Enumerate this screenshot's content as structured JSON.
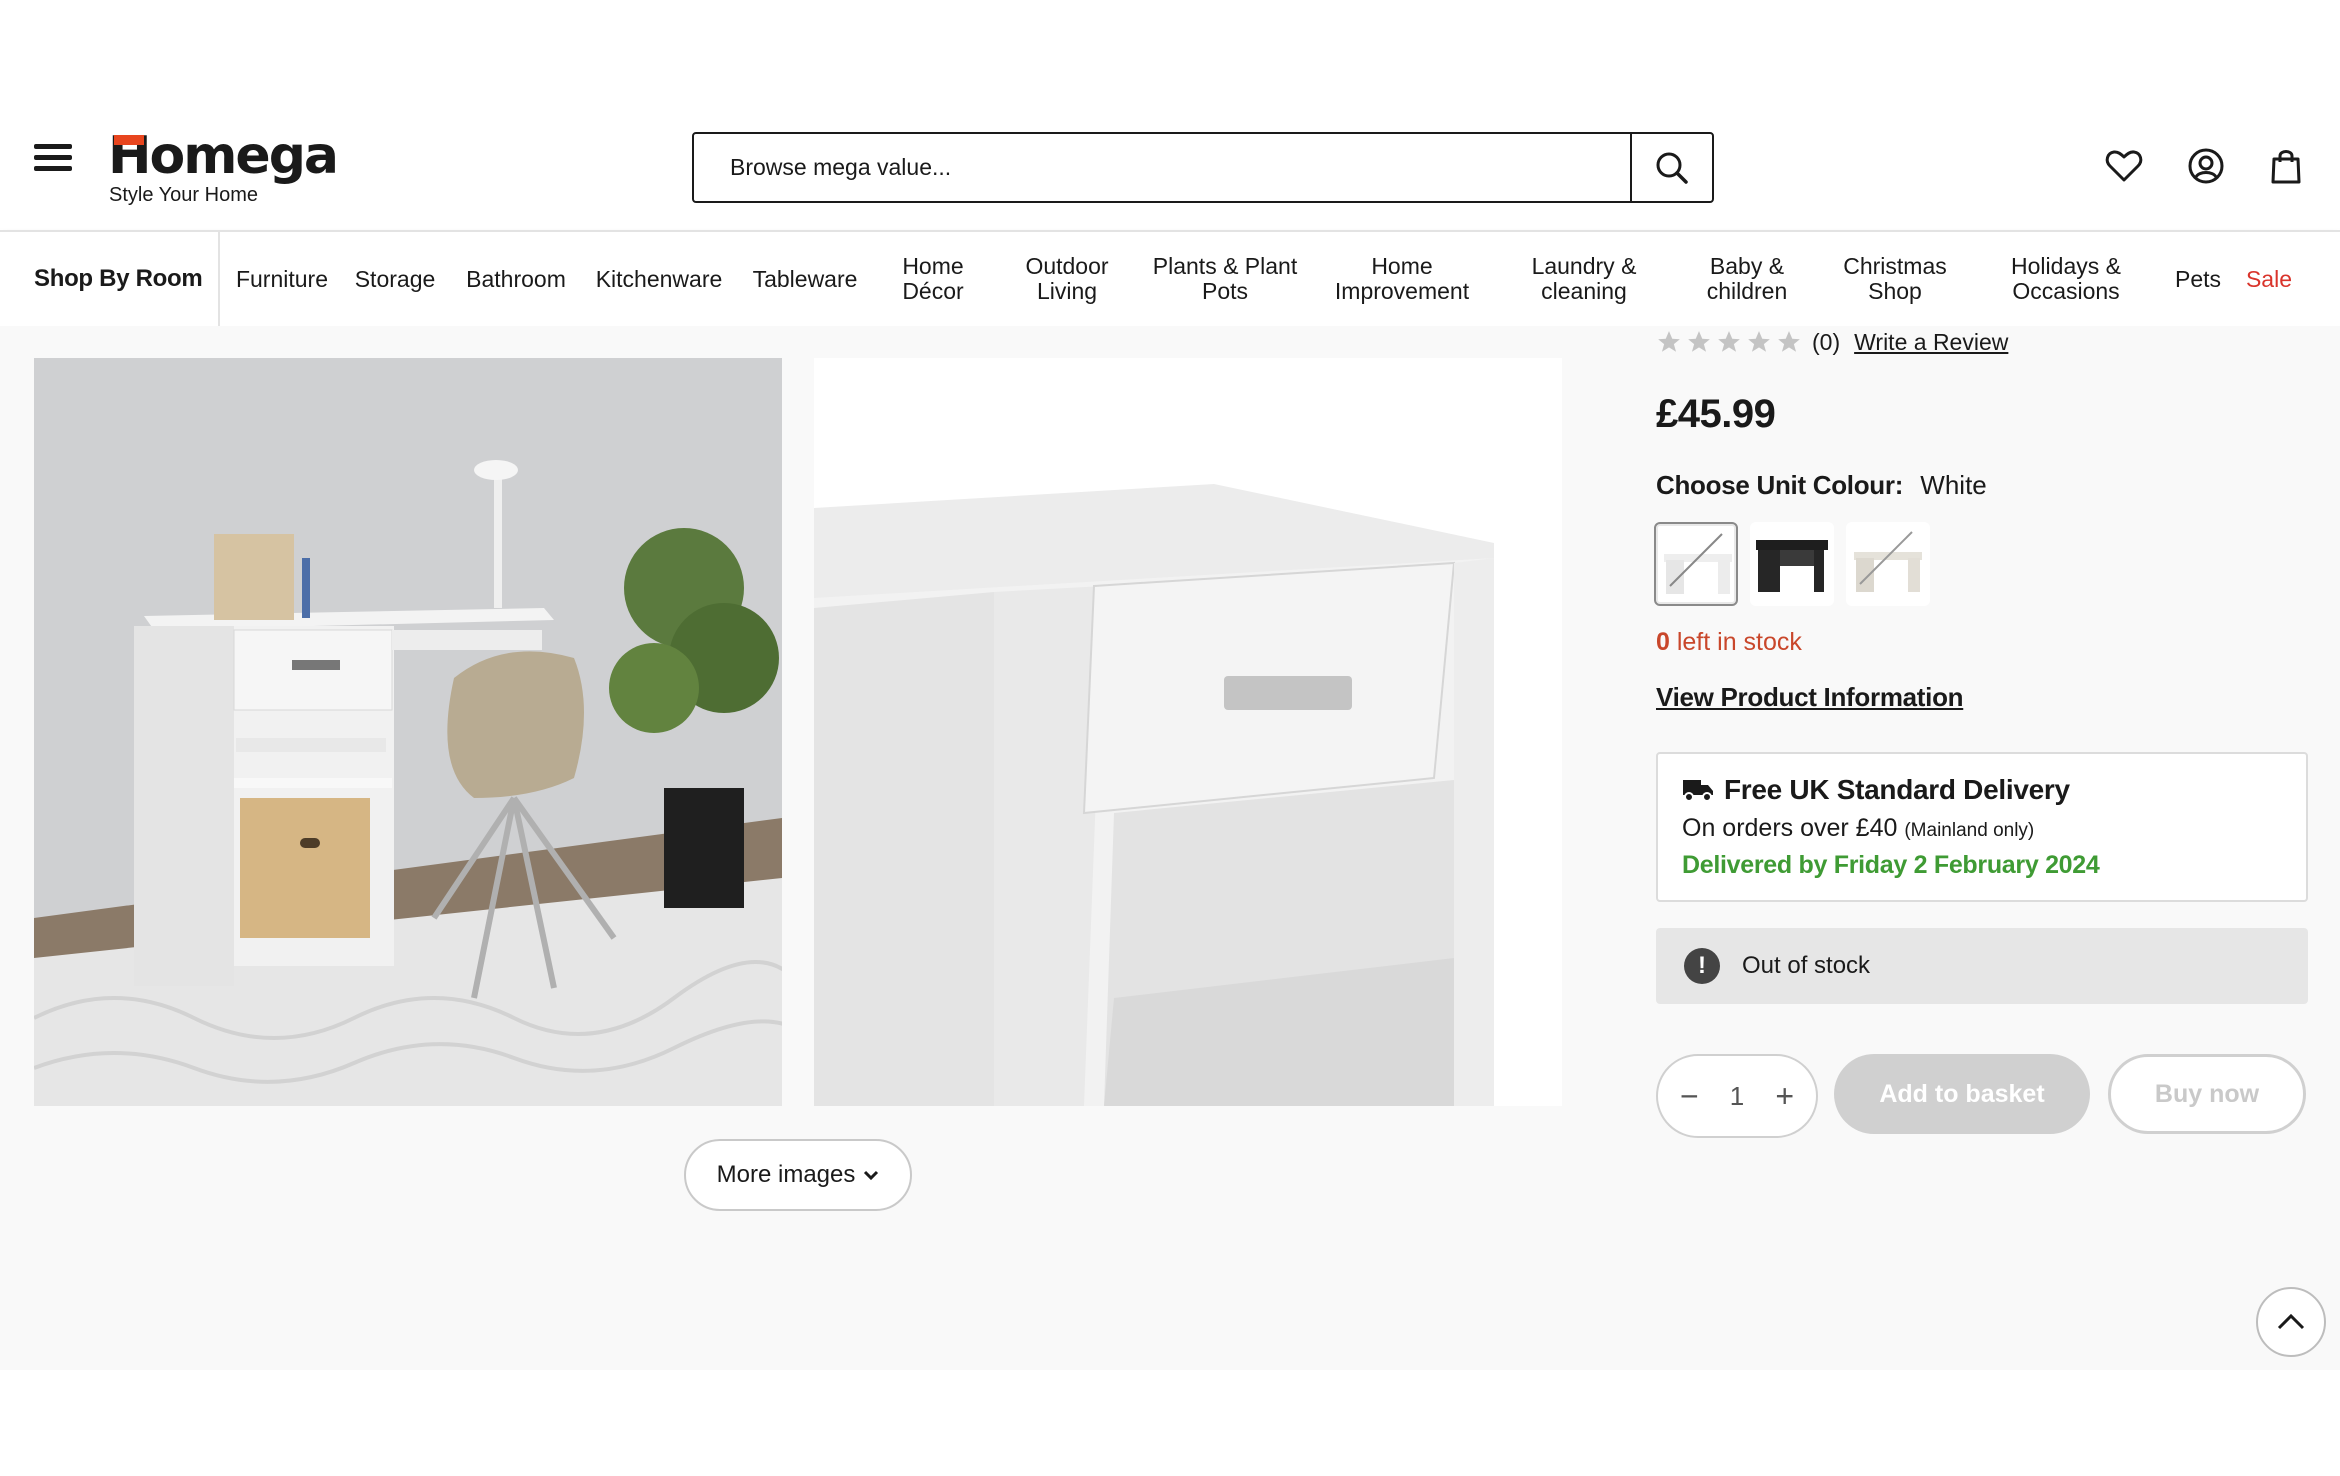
{
  "header": {
    "logo_text": "Homega",
    "logo_tagline": "Style Your Home",
    "search_placeholder": "Browse mega value..."
  },
  "nav": {
    "shop_by_room": "Shop By Room",
    "items": [
      "Furniture",
      "Storage",
      "Bathroom",
      "Kitchenware",
      "Tableware",
      "Home\nDécor",
      "Outdoor\nLiving",
      "Plants & Plant\nPots",
      "Home\nImprovement",
      "Laundry &\ncleaning",
      "Baby &\nchildren",
      "Christmas\nShop",
      "Holidays &\nOccasions",
      "Pets",
      "Sale"
    ]
  },
  "gallery": {
    "more_images": "More images"
  },
  "product": {
    "review_count": "(0)",
    "write_review": "Write a Review",
    "rating": 0,
    "price": "£45.99",
    "colour_label": "Choose Unit Colour:",
    "colour_value": "White",
    "stock_count": "0",
    "stock_text": " left in stock",
    "view_info": "View Product Information",
    "quantity": "1",
    "add_to_basket": "Add to basket",
    "buy_now": "Buy now"
  },
  "delivery": {
    "title": "Free UK Standard Delivery",
    "subtitle": "On orders over £40",
    "subtitle_note": "(Mainland only)",
    "date": "Delivered by Friday 2 February 2024"
  },
  "stock_status": {
    "message": "Out of stock"
  },
  "colors": {
    "brand_accent": "#e8451e",
    "sale": "#d9342b",
    "stock_warning": "#c9472b",
    "delivery_green": "#3f9b34"
  }
}
